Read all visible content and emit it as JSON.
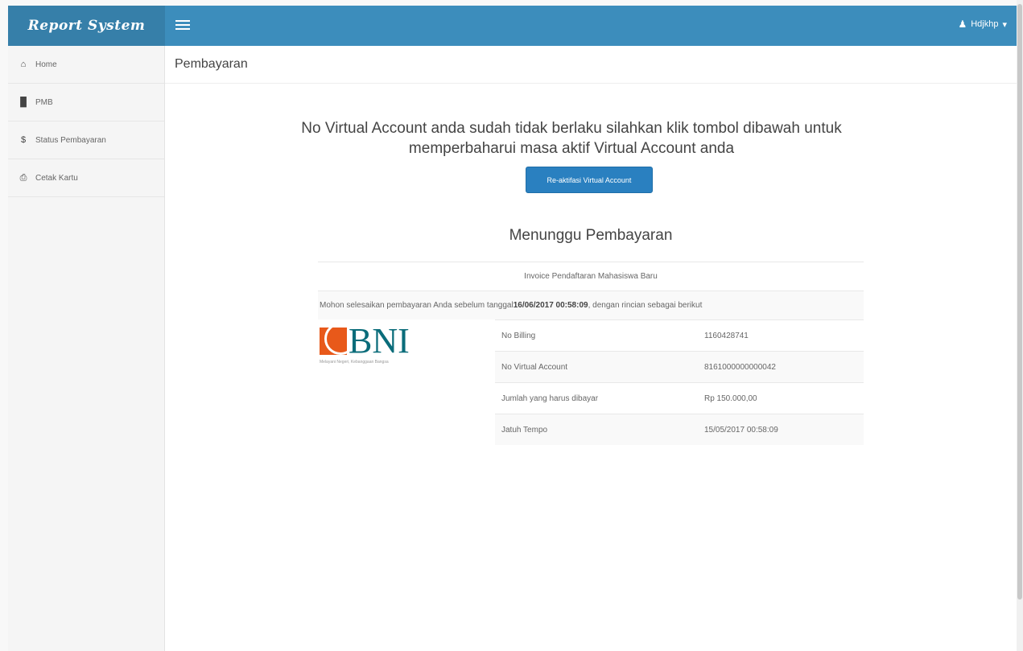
{
  "navbar": {
    "brand": "Report System",
    "user_label": "Hdjkhp"
  },
  "sidebar": {
    "items": [
      {
        "icon": "home-icon",
        "glyph": "⌂",
        "label": "Home"
      },
      {
        "icon": "barcode-icon",
        "glyph": "█",
        "label": "PMB"
      },
      {
        "icon": "dollar-icon",
        "glyph": "$",
        "label": "Status Pembayaran"
      },
      {
        "icon": "print-icon",
        "glyph": "⎙",
        "label": "Cetak Kartu"
      }
    ]
  },
  "main": {
    "page_title": "Pembayaran",
    "notice": "No Virtual Account anda sudah tidak berlaku silahkan klik tombol dibawah untuk memperbaharui masa aktif Virtual Account anda",
    "reactivate_button": "Re-aktifasi Virtual Account",
    "waiting_title": "Menunggu Pembayaran",
    "invoice_title": "Invoice Pendaftaran Mahasiswa Baru",
    "instruction_prefix": "Mohon selesaikan pembayaran Anda sebelum tanggal ",
    "instruction_date": "16/06/2017 00:58:09",
    "instruction_suffix": ", dengan rincian sebagai berikut",
    "bank_logo_text": "BNI",
    "bank_tagline": "Melayani Negeri, Kebanggaan Bangsa",
    "details": [
      {
        "label": "No Billing",
        "value": "1160428741"
      },
      {
        "label": "No Virtual Account",
        "value": "8161000000000042"
      },
      {
        "label": "Jumlah yang harus dibayar",
        "value": "Rp 150.000,00"
      },
      {
        "label": "Jatuh Tempo",
        "value": "15/05/2017 00:58:09"
      }
    ]
  },
  "colors": {
    "navbar": "#3c8dbc",
    "brand_bg": "#367fa9",
    "button": "#2a80c0",
    "bni_orange": "#e8591a",
    "bni_teal": "#0a6c7a"
  }
}
